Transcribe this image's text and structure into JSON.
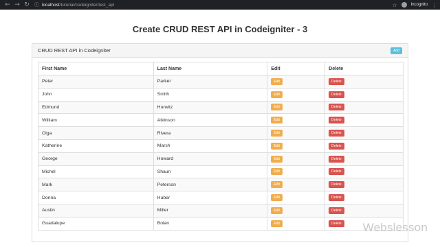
{
  "browser": {
    "url_host": "localhost",
    "url_path": "/tutorial/codeigniter/test_api",
    "incognito_label": "Incognito"
  },
  "page": {
    "title": "Create CRUD REST API in Codeigniter - 3"
  },
  "panel": {
    "heading": "CRUD REST API in Codeigniter",
    "add_label": "Add"
  },
  "table": {
    "headers": [
      "First Name",
      "Last Name",
      "Edit",
      "Delete"
    ],
    "edit_label": "Edit",
    "delete_label": "Delete",
    "rows": [
      {
        "first": "Peter",
        "last": "Parker"
      },
      {
        "first": "John",
        "last": "Smith"
      },
      {
        "first": "Edmund",
        "last": "Hurwitz"
      },
      {
        "first": "William",
        "last": "Atkinson"
      },
      {
        "first": "Olga",
        "last": "Rivera"
      },
      {
        "first": "Katherine",
        "last": "Marsh"
      },
      {
        "first": "George",
        "last": "Howard"
      },
      {
        "first": "Michel",
        "last": "Shaun"
      },
      {
        "first": "Mark",
        "last": "Peterson"
      },
      {
        "first": "Donna",
        "last": "Huber"
      },
      {
        "first": "Austin",
        "last": "Miller"
      },
      {
        "first": "Guadalupe",
        "last": "Bolan"
      }
    ]
  },
  "watermark": "Webslesson",
  "colors": {
    "add": "#5bc0de",
    "edit": "#f0ad4e",
    "delete": "#d9534f"
  }
}
